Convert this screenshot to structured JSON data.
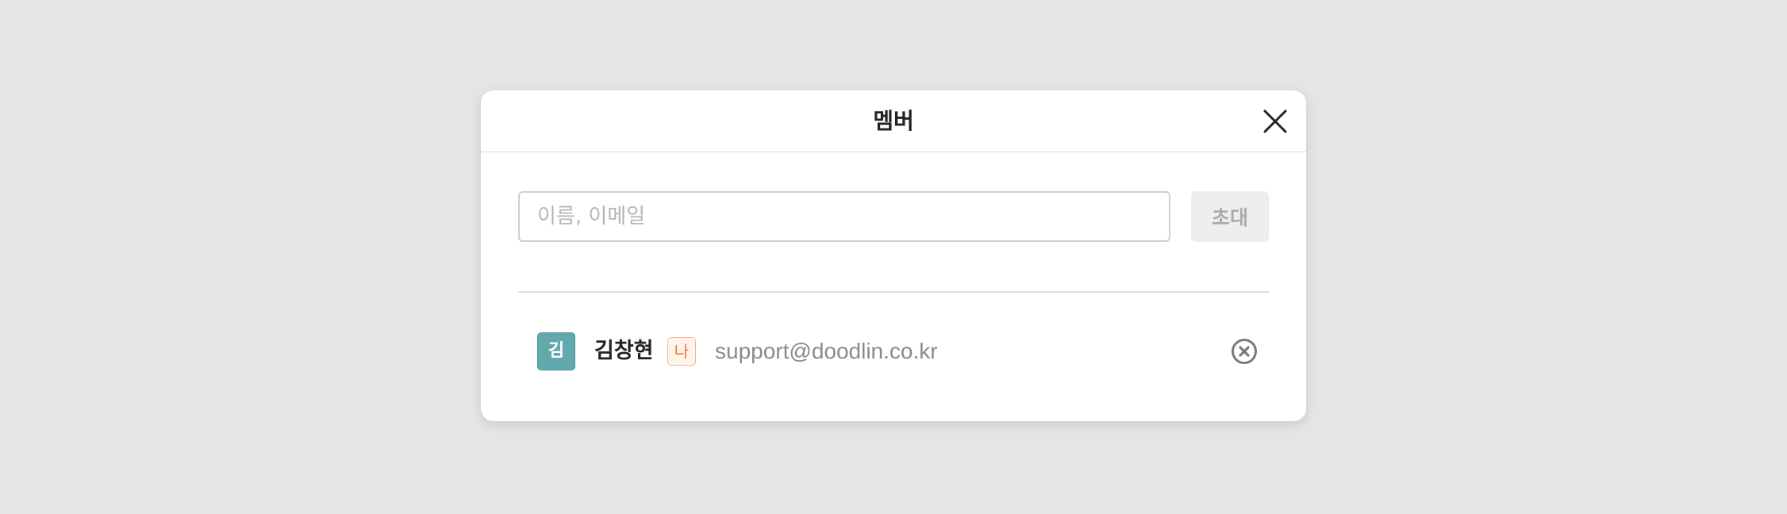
{
  "modal": {
    "title": "멤버"
  },
  "search": {
    "placeholder": "이름, 이메일",
    "value": ""
  },
  "invite_button": {
    "label": "초대"
  },
  "members": [
    {
      "avatar_initial": "김",
      "name": "김창현",
      "me_badge": "나",
      "email": "support@doodlin.co.kr"
    }
  ],
  "colors": {
    "background": "#e5e5e5",
    "avatar": "#62a9ae",
    "me_badge_text": "#ee7a3c",
    "me_badge_bg": "#fff3ea",
    "invite_disabled_bg": "#eeeeee"
  },
  "icons": {
    "close": "close-icon",
    "remove_member": "remove-circle-x-icon"
  }
}
